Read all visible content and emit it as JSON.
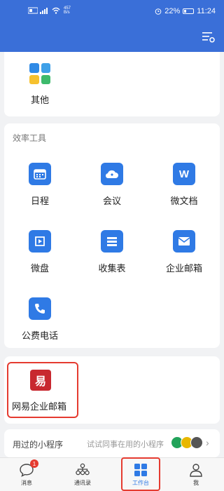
{
  "status_bar": {
    "network": "4G",
    "speed_top": "457",
    "speed_bottom": "B/s",
    "battery": "22%",
    "time": "11:24"
  },
  "top_card": {
    "apps": [
      {
        "label": "其他",
        "icon": "grid-apps-icon"
      }
    ]
  },
  "tools": {
    "title": "效率工具",
    "apps": [
      {
        "label": "日程",
        "icon": "calendar-icon"
      },
      {
        "label": "会议",
        "icon": "cloud-meeting-icon"
      },
      {
        "label": "微文档",
        "icon": "word-doc-icon",
        "glyph": "W"
      },
      {
        "label": "微盘",
        "icon": "drive-icon"
      },
      {
        "label": "收集表",
        "icon": "form-icon"
      },
      {
        "label": "企业邮箱",
        "icon": "mail-icon"
      },
      {
        "label": "公费电话",
        "icon": "phone-icon"
      }
    ]
  },
  "recent": {
    "app_label": "网易企业邮箱",
    "icon_glyph": "易"
  },
  "mini_programs": {
    "label": "用过的小程序",
    "hint": "试试同事在用的小程序",
    "badge_colors": [
      "#22a35a",
      "#e8b700",
      "#555555"
    ],
    "arrow": "›"
  },
  "tabbar": {
    "tabs": [
      {
        "label": "消息",
        "icon": "message-icon",
        "badge": "1"
      },
      {
        "label": "通讯录",
        "icon": "contacts-icon"
      },
      {
        "label": "工作台",
        "icon": "workbench-icon",
        "active": true
      },
      {
        "label": "我",
        "icon": "profile-icon"
      }
    ]
  },
  "colors": {
    "header": "#3a6fd8",
    "app_icon": "#2f7ae5",
    "highlight": "#e53b30",
    "netease": "#c8282f"
  }
}
